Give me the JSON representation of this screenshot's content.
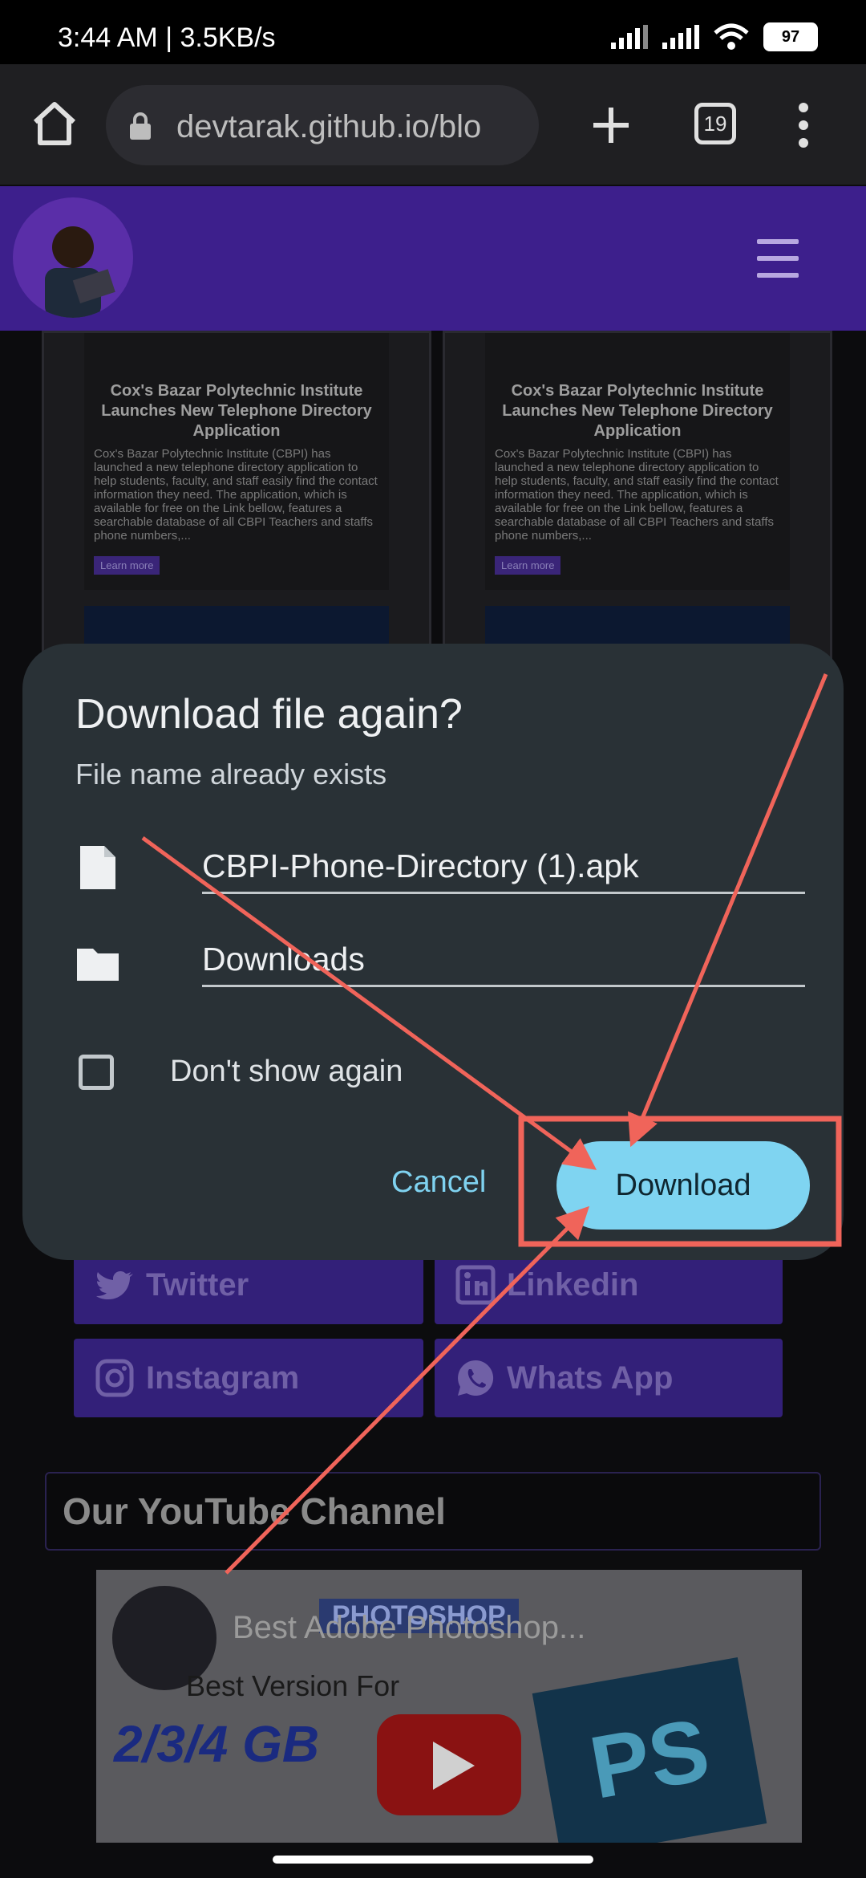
{
  "status_bar": {
    "time": "3:44 AM",
    "speed": "3.5KB/s",
    "battery": "97"
  },
  "browser": {
    "url": "devtarak.github.io/blo",
    "tab_count": "19"
  },
  "page": {
    "cards": [
      {
        "title": "Cox's Bazar Polytechnic Institute Launches New Telephone Directory Application",
        "excerpt": "Cox's Bazar Polytechnic Institute (CBPI) has launched a new telephone directory application to help students, faculty, and staff easily find the contact information they need. The application, which is available for free on the Link bellow, features a searchable database of all CBPI Teachers and staffs phone numbers,...",
        "button": "Learn more"
      },
      {
        "title": "Cox's Bazar Polytechnic Institute Launches New Telephone Directory Application",
        "excerpt": "Cox's Bazar Polytechnic Institute (CBPI) has launched a new telephone directory application to help students, faculty, and staff easily find the contact information they need. The application, which is available for free on the Link bellow, features a searchable database of all CBPI Teachers and staffs phone numbers,...",
        "button": "Learn more"
      }
    ],
    "social": {
      "twitter": "Twitter",
      "linkedin": "Linkedin",
      "instagram": "Instagram",
      "whatsapp": "Whats App"
    },
    "youtube_heading": "Our YouTube Channel",
    "video": {
      "title": "Best Adobe Photoshop...",
      "subtitle": "Best Version For",
      "gb_text": "2/3/4 GB",
      "badge": "PHOTOSHOP",
      "ps_logo": "PS"
    }
  },
  "dialog": {
    "title": "Download file again?",
    "subtitle": "File name already exists",
    "file_name": "CBPI-Phone-Directory (1).apk",
    "folder": "Downloads",
    "checkbox_label": "Don't show again",
    "cancel_label": "Cancel",
    "download_label": "Download"
  },
  "colors": {
    "site_header": "#3d1f8c",
    "dialog_bg": "#293136",
    "accent": "#7fd4f1",
    "annotation": "#f0645a"
  }
}
